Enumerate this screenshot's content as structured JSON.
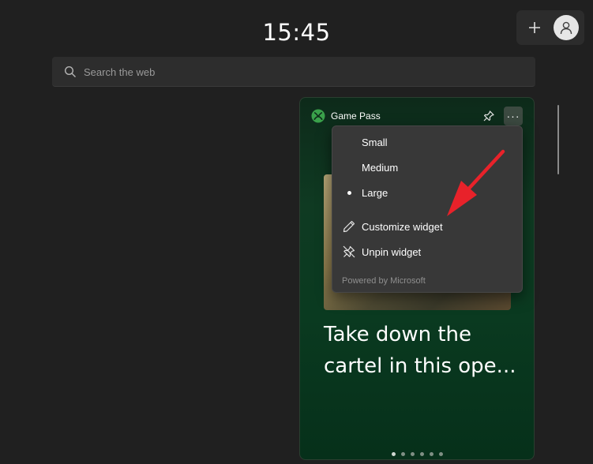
{
  "header": {
    "clock": "15:45",
    "add_icon": "plus-icon",
    "avatar_icon": "person-icon"
  },
  "search": {
    "placeholder": "Search the web",
    "icon": "search-icon"
  },
  "widget": {
    "title": "Game Pass",
    "logo_icon": "xbox-logo",
    "pin_icon": "pin-icon",
    "more_label": "···",
    "headline_line1": "Take down the",
    "headline_line2": "cartel in this ope...",
    "pager": {
      "count": 6,
      "active_index": 0
    }
  },
  "menu": {
    "items": [
      {
        "label": "Small",
        "selected": false
      },
      {
        "label": "Medium",
        "selected": false
      },
      {
        "label": "Large",
        "selected": true
      },
      {
        "label": "Customize widget",
        "icon": "pencil-icon"
      },
      {
        "label": "Unpin widget",
        "icon": "unpin-icon"
      }
    ],
    "footer": "Powered by Microsoft"
  },
  "colors": {
    "background": "#202020",
    "menu_bg": "#383838",
    "widget_green": "#0f3a22",
    "annotation_arrow": "#e8222a"
  }
}
